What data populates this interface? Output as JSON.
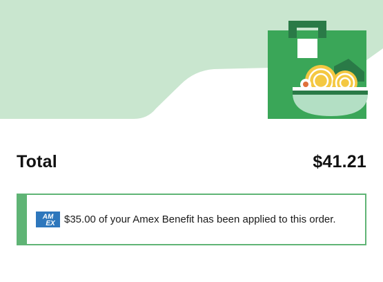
{
  "summary": {
    "total_label": "Total",
    "total_value": "$41.21"
  },
  "benefit": {
    "message": "$35.00 of your Amex Benefit has been applied to this order.",
    "logo_text": "AM EX",
    "icon": "amex-card-icon"
  },
  "illustration": {
    "icon": "grocery-bag-noodle-bowl-illustration"
  },
  "colors": {
    "hero_background": "#c9e6cf",
    "bag_green": "#3aa658",
    "bag_dark_green": "#2a7a47",
    "bowl_mint": "#b3dfc4",
    "noodle_yellow": "#f4c842",
    "benefit_accent": "#5fb475",
    "amex_blue": "#2e77bc"
  }
}
